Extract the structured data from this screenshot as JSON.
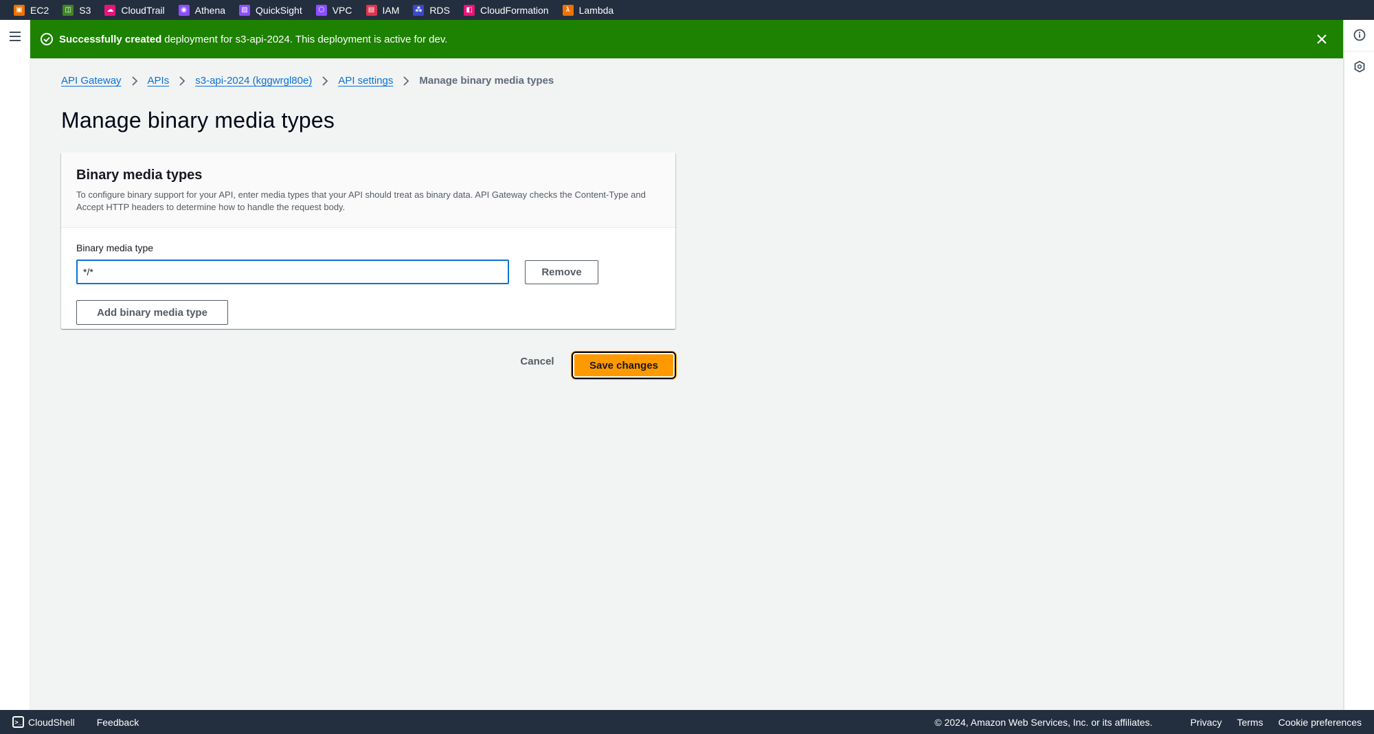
{
  "services_bar": [
    {
      "label": "EC2",
      "icon": "ec2-icon",
      "color": "#ed7100"
    },
    {
      "label": "S3",
      "icon": "s3-icon",
      "color": "#3f8624"
    },
    {
      "label": "CloudTrail",
      "icon": "cloudtrail-icon",
      "color": "#e7157b"
    },
    {
      "label": "Athena",
      "icon": "athena-icon",
      "color": "#8c4fff"
    },
    {
      "label": "QuickSight",
      "icon": "quicksight-icon",
      "color": "#8c4fff"
    },
    {
      "label": "VPC",
      "icon": "vpc-icon",
      "color": "#8c4fff"
    },
    {
      "label": "IAM",
      "icon": "iam-icon",
      "color": "#dd344c"
    },
    {
      "label": "RDS",
      "icon": "rds-icon",
      "color": "#3b48cc"
    },
    {
      "label": "CloudFormation",
      "icon": "cloudformation-icon",
      "color": "#e7157b"
    },
    {
      "label": "Lambda",
      "icon": "lambda-icon",
      "color": "#ed7100"
    }
  ],
  "flash": {
    "strong": "Successfully created",
    "message": "deployment for s3-api-2024. This deployment is active for dev.",
    "type": "success",
    "color": "#1d8102"
  },
  "breadcrumbs": {
    "items": [
      {
        "label": "API Gateway"
      },
      {
        "label": "APIs"
      },
      {
        "label": "s3-api-2024 (kggwrgl80e)"
      },
      {
        "label": "API settings"
      }
    ],
    "current": "Manage binary media types"
  },
  "page": {
    "title": "Manage binary media types"
  },
  "container": {
    "title": "Binary media types",
    "description": "To configure binary support for your API, enter media types that your API should treat as binary data. API Gateway checks the Content-Type and Accept HTTP headers to determine how to handle the request body.",
    "field_label": "Binary media type",
    "input_value": "*/*",
    "remove_label": "Remove",
    "add_label": "Add binary media type"
  },
  "actions": {
    "cancel_label": "Cancel",
    "save_label": "Save changes",
    "save_color": "#ff9900"
  },
  "footer": {
    "cloudshell_label": "CloudShell",
    "feedback_label": "Feedback",
    "copyright": "© 2024, Amazon Web Services, Inc. or its affiliates.",
    "privacy_label": "Privacy",
    "terms_label": "Terms",
    "cookie_label": "Cookie preferences"
  }
}
